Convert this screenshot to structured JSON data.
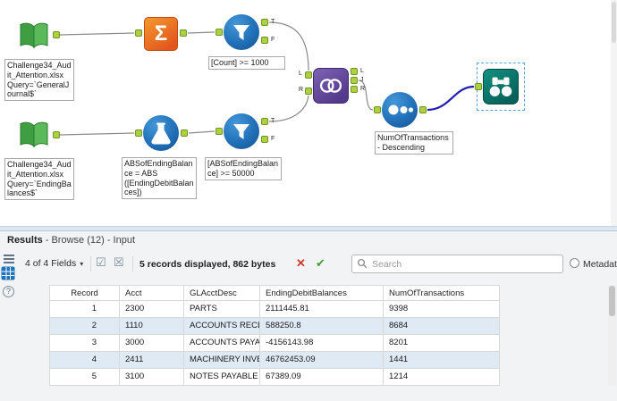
{
  "colors": {
    "tool_blue": "#2170b8",
    "anchor_green": "#aed143",
    "summarize_orange": "#e2571e",
    "join_purple": "#53398a",
    "browse_teal": "#06615a",
    "wire_gray": "#8a8a8a",
    "wire_selected_navy": "#1f1fae",
    "row_alt_blue": "#dfeaf5",
    "selection_dashed_blue": "#56a0e8"
  },
  "icons": {
    "sigma": "Σ",
    "chevron_down": "▾",
    "checkbox_checked": "☑",
    "checkbox_crossed": "☒",
    "clear_x": "✕",
    "accept_check": "✔",
    "help": "?"
  },
  "canvas": {
    "anchors": {
      "t": "T",
      "f": "F",
      "l": "L",
      "j": "J",
      "r": "R"
    },
    "tools": {
      "input_general_journal": {
        "annotation": "Challenge34_Audit_Attention.xlsx\nQuery=`GeneralJournal$`"
      },
      "filter_count": {
        "annotation": "[Count] >= 1000"
      },
      "input_ending_balances": {
        "annotation": "Challenge34_Audit_Attention.xlsx\nQuery=`EndingBalances$`"
      },
      "formula_abs": {
        "annotation": "ABSofEndingBalance = ABS\n([EndingDebitBalances])"
      },
      "filter_abs": {
        "annotation": "[ABSofEndingBalance] >= 50000"
      },
      "sort": {
        "annotation": "NumOfTransactions - Descending"
      }
    }
  },
  "results": {
    "title": "Results",
    "subtitle": "- Browse (12) - Input",
    "toolbar": {
      "fields_dropdown": "4 of 4 Fields",
      "records_info": "5 records displayed, 862 bytes",
      "search_placeholder": "Search",
      "metadata_label": "Metadata"
    },
    "table": {
      "columns": [
        "Record",
        "Acct",
        "GLAcctDesc",
        "EndingDebitBalances",
        "NumOfTransactions"
      ],
      "rows": [
        [
          "1",
          "2300",
          "PARTS",
          "2111445.81",
          "9398"
        ],
        [
          "2",
          "1110",
          "ACCOUNTS RECEIVABLE",
          "588250.8",
          "8684"
        ],
        [
          "3",
          "3000",
          "ACCOUNTS PAYABLE",
          "-4156143.98",
          "8201"
        ],
        [
          "4",
          "2411",
          "MACHINERY INVENTORY",
          "46762453.09",
          "1441"
        ],
        [
          "5",
          "3100",
          "NOTES PAYABLE",
          "67389.09",
          "1214"
        ]
      ]
    }
  }
}
